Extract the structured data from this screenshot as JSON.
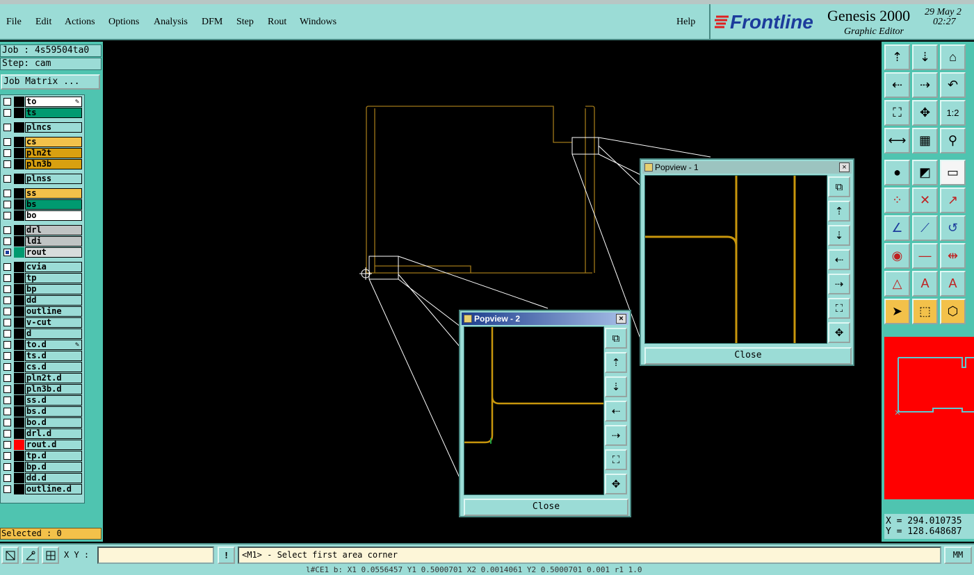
{
  "menu": {
    "items": [
      "File",
      "Edit",
      "Actions",
      "Options",
      "Analysis",
      "DFM",
      "Step",
      "Rout",
      "Windows"
    ],
    "help": "Help"
  },
  "brand": {
    "logo": "Frontline",
    "product": "Genesis 2000",
    "subtitle": "Graphic Editor",
    "date": "29 May 2",
    "time": "02:27"
  },
  "left": {
    "job": "Job : 4s59504ta0",
    "step": "Step: cam",
    "job_matrix": "Job Matrix ...",
    "selected": "Selected : 0",
    "layers": [
      {
        "name": "to",
        "bg": "#ffffff",
        "color": "#000000"
      },
      {
        "name": "ts",
        "bg": "#009a70",
        "color": "#000000"
      },
      {
        "name": "plncs",
        "bg": "#9bdcd6",
        "color": "#000000"
      },
      {
        "name": "cs",
        "bg": "#f3c14a",
        "color": "#000000"
      },
      {
        "name": "pln2t",
        "bg": "#d8a010",
        "color": "#000000"
      },
      {
        "name": "pln3b",
        "bg": "#d8a010",
        "color": "#000000"
      },
      {
        "name": "plnss",
        "bg": "#9bdcd6",
        "color": "#000000"
      },
      {
        "name": "ss",
        "bg": "#f3c14a",
        "color": "#000000"
      },
      {
        "name": "bs",
        "bg": "#009a70",
        "color": "#000000"
      },
      {
        "name": "bo",
        "bg": "#ffffff",
        "color": "#000000"
      },
      {
        "name": "drl",
        "bg": "#c0c4c4",
        "color": "#000000"
      },
      {
        "name": "ldi",
        "bg": "#c0c4c4",
        "color": "#000000"
      },
      {
        "name": "rout",
        "bg": "#d8dcdc",
        "color": "#009a70"
      },
      {
        "name": "cvia",
        "bg": "#9bdcd6",
        "color": "#000000"
      },
      {
        "name": "tp",
        "bg": "#9bdcd6",
        "color": "#000000"
      },
      {
        "name": "bp",
        "bg": "#9bdcd6",
        "color": "#000000"
      },
      {
        "name": "dd",
        "bg": "#9bdcd6",
        "color": "#000000"
      },
      {
        "name": "outline",
        "bg": "#9bdcd6",
        "color": "#000000"
      },
      {
        "name": "v-cut",
        "bg": "#9bdcd6",
        "color": "#000000"
      },
      {
        "name": "d",
        "bg": "#9bdcd6",
        "color": "#000000"
      },
      {
        "name": "to.d",
        "bg": "#9bdcd6",
        "color": "#000000"
      },
      {
        "name": "ts.d",
        "bg": "#9bdcd6",
        "color": "#000000"
      },
      {
        "name": "cs.d",
        "bg": "#9bdcd6",
        "color": "#000000"
      },
      {
        "name": "pln2t.d",
        "bg": "#9bdcd6",
        "color": "#000000"
      },
      {
        "name": "pln3b.d",
        "bg": "#9bdcd6",
        "color": "#000000"
      },
      {
        "name": "ss.d",
        "bg": "#9bdcd6",
        "color": "#000000"
      },
      {
        "name": "bs.d",
        "bg": "#9bdcd6",
        "color": "#000000"
      },
      {
        "name": "bo.d",
        "bg": "#9bdcd6",
        "color": "#000000"
      },
      {
        "name": "drl.d",
        "bg": "#9bdcd6",
        "color": "#000000"
      },
      {
        "name": "rout.d",
        "bg": "#9bdcd6",
        "color": "#ff0000"
      },
      {
        "name": "tp.d",
        "bg": "#9bdcd6",
        "color": "#000000"
      },
      {
        "name": "bp.d",
        "bg": "#9bdcd6",
        "color": "#000000"
      },
      {
        "name": "dd.d",
        "bg": "#9bdcd6",
        "color": "#000000"
      },
      {
        "name": "outline.d",
        "bg": "#9bdcd6",
        "color": "#000000"
      }
    ]
  },
  "right": {
    "tool_buttons": [
      "move-up",
      "move-down",
      "home",
      "pan-left",
      "pan-right",
      "undo-zoom",
      "fit-view",
      "zoom-center",
      "one-to-two",
      "measure",
      "grid",
      "snap",
      "drill-hit",
      "color-edit",
      "ruler",
      "nodes",
      "cross",
      "connect",
      "line-angle",
      "line-edit",
      "arc",
      "pad-add",
      "line-add",
      "dimension",
      "text-a",
      "text-b",
      "text-c",
      "select",
      "select-box",
      "select-poly"
    ],
    "x": "X = 294.010735",
    "y": "Y = 128.648687",
    "accent": "#ff0000"
  },
  "bottom": {
    "xy_label": "X Y :",
    "xy_value": "",
    "alert": "!",
    "prompt": "<M1> - Select first area corner",
    "units": "MM",
    "status": "l#CE1 b:  X1 0.0556457 Y1 0.5000701 X2 0.0014061 Y2 0.5000701 0.001 r1 1.0"
  },
  "popview1": {
    "title": "Popview - 1",
    "close": "Close",
    "close_x": "×"
  },
  "popview2": {
    "title": "Popview - 2",
    "close": "Close",
    "close_x": "×"
  },
  "colors": {
    "trace": "#c8960c",
    "outline": "#a07818",
    "leader": "#ffffff",
    "panel": "#9bdcd6",
    "panel_dark": "#4fc4b0"
  }
}
